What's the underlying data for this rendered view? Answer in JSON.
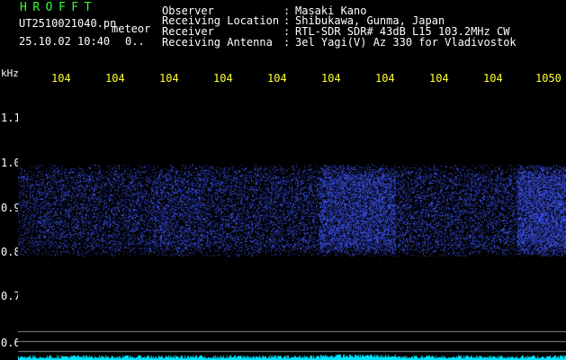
{
  "app_title": "HROFFT",
  "file_name": "UT2510021040.pn",
  "meteor_label": "meteor",
  "datetime": "25.10.02 10:40",
  "meteor_count": "0..",
  "header": [
    {
      "label": "Observer",
      "value": "Masaki Kano"
    },
    {
      "label": "Receiving Location",
      "value": "Shibukawa, Gunma, Japan"
    },
    {
      "label": "Receiver",
      "value": "RTL-SDR SDR# 43dB L15 103.2MHz CW"
    },
    {
      "label": "Receiving Antenna",
      "value": "3el Yagi(V) Az 330 for Vladivostok"
    }
  ],
  "colon": ":",
  "y_axis": {
    "unit": "kHz",
    "ticks": [
      "1.1",
      "1.0",
      "0.9",
      "0.8",
      "0.7",
      "0.6"
    ]
  },
  "x_axis_ticks": [
    "104",
    "104",
    "104",
    "104",
    "104",
    "104",
    "104",
    "104",
    "104",
    "1050"
  ],
  "colors": {
    "background": "#000000",
    "header_green": "#33ff33",
    "header_white": "#ffffff",
    "tick_yellow": "#ffff33",
    "signal_blue": "#3a4cff",
    "baseline_cyan": "#00e5ff",
    "grid_gray": "#8a8a8a"
  }
}
